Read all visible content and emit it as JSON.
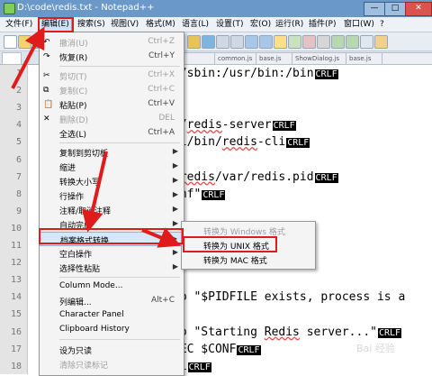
{
  "window": {
    "title": "D:\\code\\redis.txt - Notepad++",
    "minimize": "—",
    "maximize": "□",
    "close": "✕"
  },
  "menubar": [
    "文件(F)",
    "编辑(E)",
    "搜索(S)",
    "视图(V)",
    "格式(M)",
    "语言(L)",
    "设置(T)",
    "宏(O)",
    "运行(R)",
    "插件(P)",
    "窗口(W)",
    "?"
  ],
  "tabs": [
    "",
    "",
    "",
    "common.js",
    "base.js",
    "ShowDialog.js",
    "base.js"
  ],
  "line_numbers": [
    "1",
    "2",
    "3",
    "4",
    "5",
    "6",
    "7",
    "8",
    "9",
    "10",
    "11",
    "12",
    "13",
    "14",
    "15",
    "16",
    "17",
    "18"
  ],
  "code": [
    {
      "pre": ":/sbin:/usr/bin:/bin",
      "sq": "",
      "post": "",
      "eol": "CRLF"
    },
    {
      "pre": "",
      "sq": "",
      "post": "",
      "eol": ""
    },
    {
      "pre": "",
      "sq": "",
      "post": "",
      "eol": ""
    },
    {
      "pre": "n/",
      "sq": "redis",
      "post": "-server",
      "eol": "CRLF"
    },
    {
      "pre": "al/bin/",
      "sq": "redis",
      "post": "-cli",
      "eol": "CRLF"
    },
    {
      "pre": "",
      "sq": "",
      "post": "",
      "eol": ""
    },
    {
      "pre": "/",
      "sq": "redis",
      "post": "/var/redis.pid",
      "eol": "CRLF"
    },
    {
      "pre": "onf\"",
      "sq": "",
      "post": "",
      "eol": "CRLF"
    },
    {
      "pre": "",
      "sq": "",
      "post": "",
      "eol": ""
    },
    {
      "pre": "",
      "sq": "",
      "post": "",
      "eol": ""
    },
    {
      "pre": "",
      "sq": "",
      "post": "",
      "eol": ""
    },
    {
      "pre": "",
      "sq": "",
      "post": "",
      "eol": ""
    },
    {
      "pre": "",
      "sq": "",
      "post": "",
      "eol": ""
    },
    {
      "pre": "ho \"$PIDFILE exists, process is a",
      "sq": "",
      "post": "",
      "eol": ""
    },
    {
      "pre": "",
      "sq": "",
      "post": "",
      "eol": ""
    },
    {
      "pre": "ho \"Starting ",
      "sq": "Redis",
      "post": " server...\"",
      "eol": "CRLF"
    },
    {
      "pre": "XEC $CONF",
      "sq": "",
      "post": "",
      "eol": "CRLF"
    },
    {
      "pre": "fi",
      "sq": "",
      "post": "",
      "eol": "CRLF"
    }
  ],
  "edit_menu": [
    {
      "label": "撤消(U)",
      "shortcut": "Ctrl+Z",
      "disabled": true
    },
    {
      "label": "恢复(R)",
      "shortcut": "Ctrl+Y",
      "disabled": false
    },
    {
      "label": "剪切(T)",
      "shortcut": "Ctrl+X",
      "disabled": true
    },
    {
      "label": "复制(C)",
      "shortcut": "Ctrl+C",
      "disabled": true
    },
    {
      "label": "粘贴(P)",
      "shortcut": "Ctrl+V",
      "disabled": false
    },
    {
      "label": "删除(D)",
      "shortcut": "DEL",
      "disabled": true
    },
    {
      "label": "全选(L)",
      "shortcut": "Ctrl+A",
      "disabled": false
    },
    {
      "label": "复制到剪切板",
      "submenu": true
    },
    {
      "label": "缩进",
      "submenu": true
    },
    {
      "label": "转换大小写",
      "submenu": true
    },
    {
      "label": "行操作",
      "submenu": true
    },
    {
      "label": "注释/取消注释",
      "submenu": true
    },
    {
      "label": "自动完成",
      "submenu": true
    },
    {
      "label": "档案格式转换",
      "submenu": true,
      "highlight": true
    },
    {
      "label": "空白操作",
      "submenu": true
    },
    {
      "label": "选择性粘贴",
      "submenu": true
    },
    {
      "label": "Column Mode..."
    },
    {
      "label": "列编辑...",
      "shortcut": "Alt+C"
    },
    {
      "label": "Character Panel"
    },
    {
      "label": "Clipboard History"
    },
    {
      "label": "设为只读"
    },
    {
      "label": "清除只读标记",
      "disabled": true
    }
  ],
  "eol_submenu": [
    {
      "label": "转换为 Windows 格式",
      "disabled": true
    },
    {
      "label": "转换为 UNIX 格式",
      "disabled": false
    },
    {
      "label": "转换为 MAC 格式",
      "disabled": false
    }
  ],
  "watermark": "Bai 经验",
  "colors": {
    "annotation_red": "#e01b1b",
    "menu_highlight": "#d7e7f7",
    "titlebar": "#6a98c9",
    "eol_marker_bg": "#000000"
  }
}
